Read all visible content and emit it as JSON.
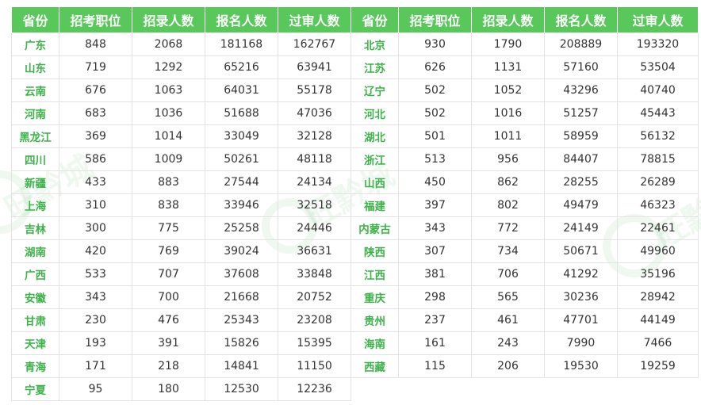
{
  "headers": [
    "省份",
    "招考职位",
    "招录人数",
    "报名人数",
    "过审人数",
    "省份",
    "招考职位",
    "招录人数",
    "报名人数",
    "过审人数"
  ],
  "rows": [
    [
      "广东",
      "848",
      "2068",
      "181168",
      "162767",
      "北京",
      "930",
      "1790",
      "208889",
      "193320"
    ],
    [
      "山东",
      "719",
      "1292",
      "65216",
      "63941",
      "江苏",
      "626",
      "1131",
      "57160",
      "53504"
    ],
    [
      "云南",
      "676",
      "1063",
      "64031",
      "55178",
      "辽宁",
      "502",
      "1052",
      "43296",
      "40740"
    ],
    [
      "河南",
      "683",
      "1036",
      "51688",
      "47036",
      "河北",
      "502",
      "1016",
      "51257",
      "45443"
    ],
    [
      "黑龙江",
      "369",
      "1014",
      "33049",
      "32128",
      "湖北",
      "501",
      "1011",
      "58959",
      "56132"
    ],
    [
      "四川",
      "586",
      "1009",
      "50261",
      "48118",
      "浙江",
      "513",
      "956",
      "84407",
      "78815"
    ],
    [
      "新疆",
      "433",
      "883",
      "27544",
      "24134",
      "山西",
      "450",
      "862",
      "28255",
      "26289"
    ],
    [
      "上海",
      "310",
      "838",
      "33946",
      "32518",
      "福建",
      "397",
      "802",
      "49479",
      "46323"
    ],
    [
      "吉林",
      "300",
      "775",
      "25258",
      "24446",
      "内蒙古",
      "343",
      "772",
      "24149",
      "22461"
    ],
    [
      "湖南",
      "420",
      "769",
      "39024",
      "36631",
      "陕西",
      "307",
      "734",
      "50671",
      "49960"
    ],
    [
      "广西",
      "533",
      "707",
      "37608",
      "33848",
      "江西",
      "381",
      "706",
      "41292",
      "35196"
    ],
    [
      "安徽",
      "343",
      "700",
      "21668",
      "20752",
      "重庆",
      "298",
      "565",
      "30236",
      "28942"
    ],
    [
      "甘肃",
      "230",
      "476",
      "25343",
      "23208",
      "贵州",
      "237",
      "461",
      "47701",
      "44149"
    ],
    [
      "天津",
      "193",
      "391",
      "15826",
      "15395",
      "海南",
      "161",
      "243",
      "7990",
      "7466"
    ],
    [
      "青海",
      "171",
      "218",
      "14841",
      "11150",
      "西藏",
      "115",
      "206",
      "19530",
      "19259"
    ],
    [
      "宁夏",
      "95",
      "180",
      "12530",
      "12236",
      "",
      "",
      "",
      "",
      ""
    ]
  ],
  "watermark": "旺黔城"
}
